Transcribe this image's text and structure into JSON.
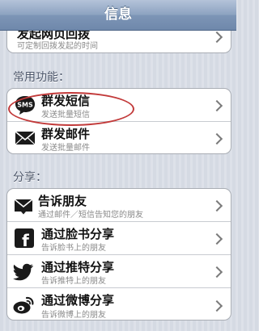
{
  "navbar": {
    "title": "信息"
  },
  "top_group": {
    "title": "发起网页回拨",
    "subtitle": "可定制回拨发起的时间"
  },
  "sections": {
    "common": {
      "header": "常用功能："
    },
    "share": {
      "header": "分享："
    }
  },
  "common_items": [
    {
      "title": "群发短信",
      "subtitle": "发送批量短信",
      "icon_label": "SMS",
      "icon": "sms-icon"
    },
    {
      "title": "群发邮件",
      "subtitle": "发送批量邮件",
      "icon": "mail-icon"
    }
  ],
  "share_items": [
    {
      "title": "告诉朋友",
      "subtitle": "通过邮件／短信告知您的朋友",
      "icon": "mail-icon"
    },
    {
      "title": "通过脸书分享",
      "subtitle": "告诉脸书上的朋友",
      "icon": "facebook-icon",
      "icon_label": "f"
    },
    {
      "title": "通过推特分享",
      "subtitle": "告诉推特上的朋友",
      "icon": "twitter-icon"
    },
    {
      "title": "通过微博分享",
      "subtitle": "告诉微博上的朋友",
      "icon": "weibo-icon"
    }
  ],
  "colors": {
    "nav_bar": "#7d95b6",
    "highlight_oval": "#c23a3a",
    "facebook": "#3b5998"
  }
}
